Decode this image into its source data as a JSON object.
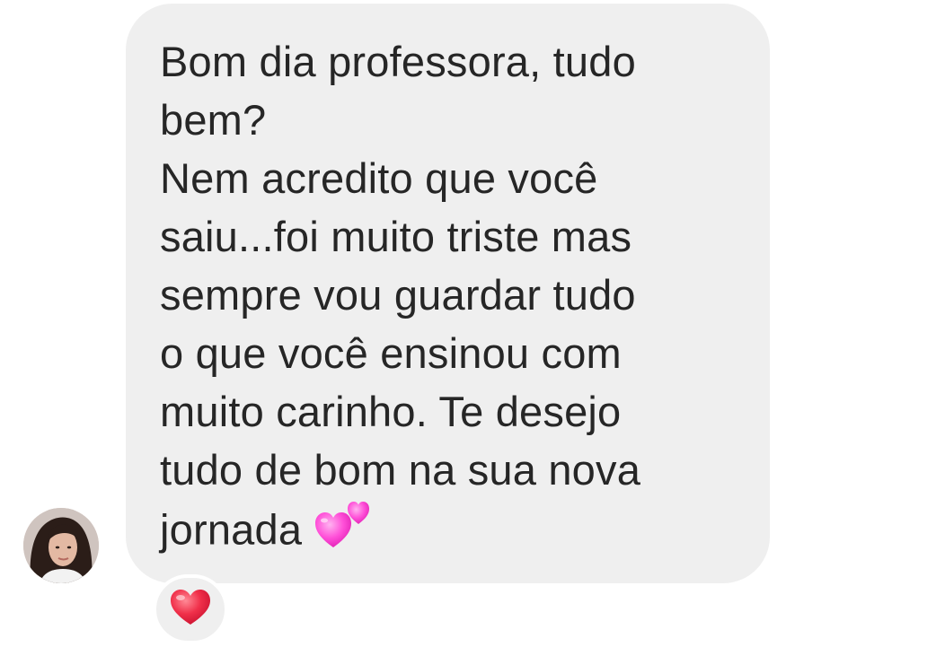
{
  "message": {
    "lines": [
      "Bom dia professora, tudo",
      "bem?",
      "Nem acredito que você",
      "saiu...foi muito triste mas",
      "sempre vou guardar tudo",
      "o que você ensinou com",
      "muito carinho. Te desejo",
      "tudo de bom na sua nova",
      "jornada"
    ],
    "trailing_emoji": "two-hearts-icon"
  },
  "reaction": {
    "emoji": "red-heart-icon"
  },
  "colors": {
    "bubble_bg": "#efefef",
    "text": "#262626",
    "heart_pink": "#ff4fd8",
    "heart_red": "#e8203a"
  }
}
